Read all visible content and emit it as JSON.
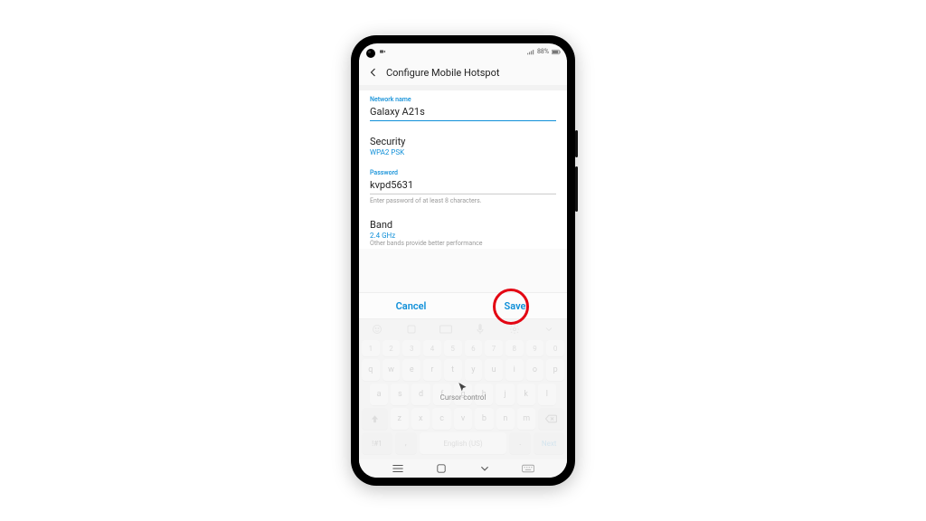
{
  "status": {
    "battery_text": "88%"
  },
  "header": {
    "title": "Configure Mobile Hotspot"
  },
  "fields": {
    "network_name": {
      "label": "Network name",
      "value": "Galaxy A21s"
    },
    "security": {
      "label": "Security",
      "value": "WPA2 PSK"
    },
    "password": {
      "label": "Password",
      "value": "kvpd5631",
      "help": "Enter password of at least 8 characters."
    },
    "band": {
      "label": "Band",
      "value": "2.4 GHz",
      "note": "Other bands provide better performance"
    }
  },
  "actions": {
    "cancel": "Cancel",
    "save": "Save"
  },
  "keyboard": {
    "row_num": [
      "1",
      "2",
      "3",
      "4",
      "5",
      "6",
      "7",
      "8",
      "9",
      "0"
    ],
    "row1": [
      "q",
      "w",
      "e",
      "r",
      "t",
      "y",
      "u",
      "i",
      "o",
      "p"
    ],
    "row2": [
      "a",
      "s",
      "d",
      "f",
      "g",
      "h",
      "j",
      "k",
      "l"
    ],
    "row3": [
      "z",
      "x",
      "c",
      "v",
      "b",
      "n",
      "m"
    ],
    "space_label": "English (US)",
    "sym_label": "!#1",
    "comma": ",",
    "period": ".",
    "next": "Next",
    "cursor_control": "Cursor control"
  }
}
